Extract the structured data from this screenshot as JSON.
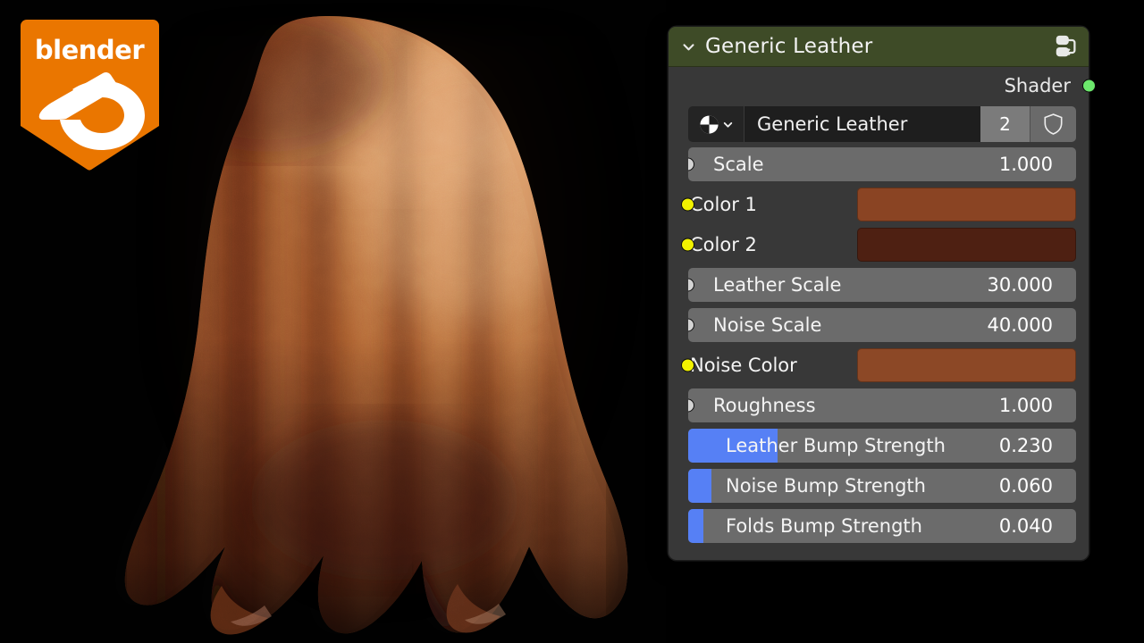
{
  "app": {
    "logo_text": "blender",
    "logo_color": "#ea7600"
  },
  "viewport": {
    "name": "leather-cloth-render",
    "background_color": "#000000",
    "material_description": "Draped leather cloth over sphere"
  },
  "node": {
    "header": {
      "title": "Generic Leather",
      "collapse_icon": "chevron-down-icon",
      "group_icon": "node-group-icon",
      "color": "#3e4b27"
    },
    "output": {
      "label": "Shader",
      "socket_color": "#6ce86c"
    },
    "datablock": {
      "icon": "material-sphere-icon",
      "dropdown_icon": "chevron-down-icon",
      "name": "Generic Leather",
      "users": "2",
      "fake_user_icon": "shield-icon"
    },
    "inputs": [
      {
        "label": "Scale",
        "value": "1.000",
        "socket": "gray",
        "type": "value",
        "fill": 0
      },
      {
        "label": "Color 1",
        "value": "",
        "socket": "yellow",
        "type": "color",
        "color": "#8a4423"
      },
      {
        "label": "Color 2",
        "value": "",
        "socket": "yellow",
        "type": "color",
        "color": "#4e2012"
      },
      {
        "label": "Leather Scale",
        "value": "30.000",
        "socket": "gray",
        "type": "value",
        "fill": 0
      },
      {
        "label": "Noise Scale",
        "value": "40.000",
        "socket": "gray",
        "type": "value",
        "fill": 0
      },
      {
        "label": "Noise Color",
        "value": "",
        "socket": "yellow",
        "type": "color",
        "color": "#8c4826"
      },
      {
        "label": "Roughness",
        "value": "1.000",
        "socket": "gray",
        "type": "value",
        "fill": 0
      },
      {
        "label": "Leather Bump Strength",
        "value": "0.230",
        "socket": "gray",
        "type": "slider",
        "fill": 23
      },
      {
        "label": "Noise Bump Strength",
        "value": "0.060",
        "socket": "gray",
        "type": "slider",
        "fill": 6
      },
      {
        "label": "Folds Bump Strength",
        "value": "0.040",
        "socket": "gray",
        "type": "slider",
        "fill": 4
      }
    ]
  },
  "theme": {
    "node_background": "#383838",
    "field_background": "#6b6b6b",
    "slider_fill": "#5680f5",
    "socket_gray": "#d3d3d3",
    "socket_yellow": "#f2f200"
  }
}
